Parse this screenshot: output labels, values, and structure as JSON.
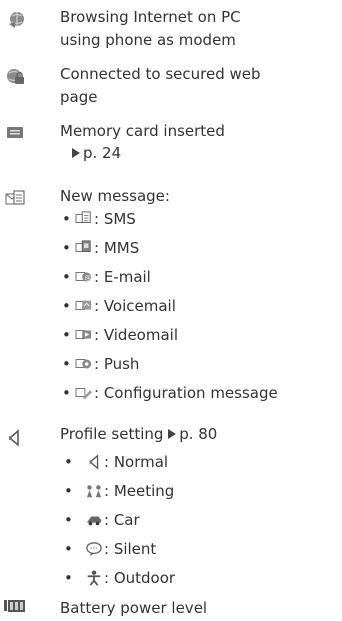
{
  "entries": [
    {
      "icon": "globe-pc-icon",
      "lines": [
        "Browsing Internet on PC",
        "using phone as modem"
      ]
    },
    {
      "icon": "globe-lock-icon",
      "lines": [
        "Connected to secured web",
        "page"
      ]
    },
    {
      "icon": "memory-card-icon",
      "lines": [
        "Memory card inserted"
      ],
      "ref": "p. 24"
    },
    {
      "icon": "new-message-icon",
      "lines": [
        "New message:"
      ]
    },
    {
      "icon": "speaker-icon",
      "lines": [
        "Profile setting"
      ],
      "ref": "p. 80"
    },
    {
      "icon": "battery-icon",
      "lines": [
        "Battery power level"
      ]
    }
  ],
  "message_types": [
    {
      "icon": "sms-icon",
      "label": ": SMS"
    },
    {
      "icon": "mms-icon",
      "label": ": MMS"
    },
    {
      "icon": "email-icon",
      "label": ": E-mail"
    },
    {
      "icon": "voicemail-icon",
      "label": ": Voicemail"
    },
    {
      "icon": "videomail-icon",
      "label": ": Videomail"
    },
    {
      "icon": "push-icon",
      "label": ": Push"
    },
    {
      "icon": "configuration-icon",
      "label": ": Configuration message"
    }
  ],
  "profiles": [
    {
      "icon": "normal-speaker-icon",
      "label": ": Normal"
    },
    {
      "icon": "meeting-icon",
      "label": ": Meeting"
    },
    {
      "icon": "car-icon",
      "label": ": Car"
    },
    {
      "icon": "silent-icon",
      "label": ": Silent"
    },
    {
      "icon": "outdoor-icon",
      "label": ": Outdoor"
    }
  ],
  "bullet": "•"
}
